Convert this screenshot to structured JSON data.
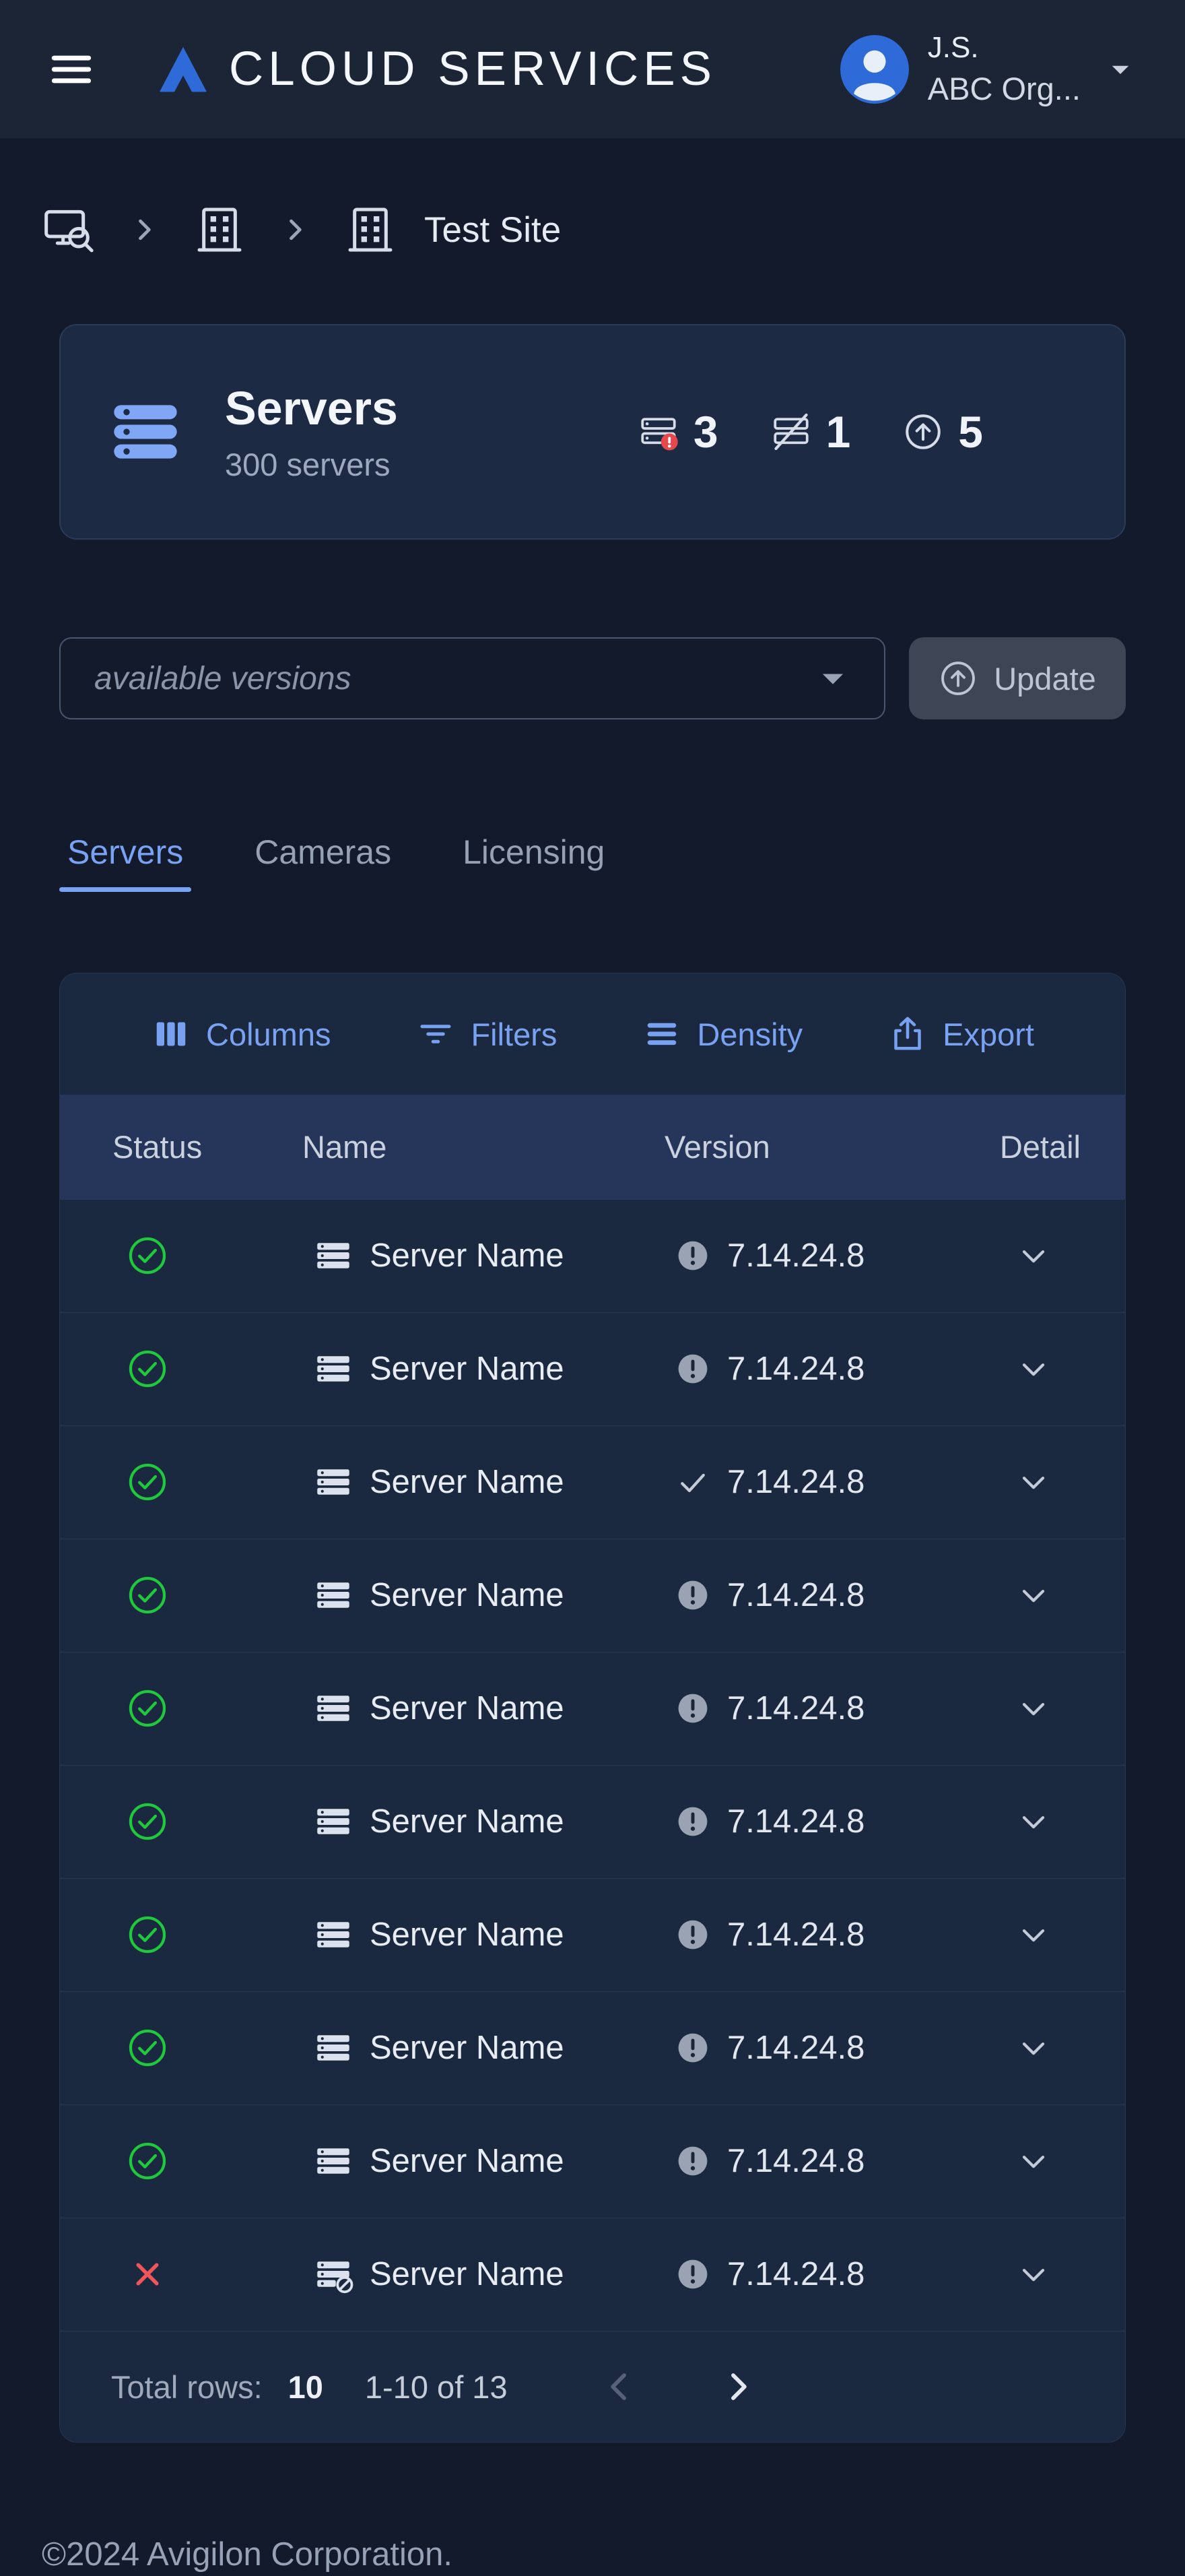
{
  "colors": {
    "accent_blue": "#79A1F2",
    "logo_blue": "#2E6BD9",
    "status_green": "#1FC93C",
    "status_red": "#F2545B"
  },
  "header": {
    "brand": "CLOUD SERVICES",
    "user_initials": "J.S.",
    "user_org": "ABC Org..."
  },
  "breadcrumb": {
    "site_label": "Test Site"
  },
  "summary": {
    "title": "Servers",
    "subtitle": "300 servers",
    "stats": [
      {
        "icon": "server-error-icon",
        "value": "3"
      },
      {
        "icon": "server-disconnected-icon",
        "value": "1"
      },
      {
        "icon": "update-available-icon",
        "value": "5"
      }
    ]
  },
  "update_bar": {
    "version_placeholder": "available versions",
    "update_label": "Update"
  },
  "tabs": [
    {
      "label": "Servers",
      "active": true
    },
    {
      "label": "Cameras",
      "active": false
    },
    {
      "label": "Licensing",
      "active": false
    }
  ],
  "table": {
    "toolbar": [
      {
        "label": "Columns",
        "icon": "columns-icon"
      },
      {
        "label": "Filters",
        "icon": "filters-icon"
      },
      {
        "label": "Density",
        "icon": "density-icon"
      },
      {
        "label": "Export",
        "icon": "export-icon"
      }
    ],
    "columns": [
      "Status",
      "Name",
      "Version",
      "Detail"
    ],
    "rows": [
      {
        "status": "ok",
        "disconnected": false,
        "name": "Server Name",
        "version": "7.14.24.8",
        "version_state": "warning"
      },
      {
        "status": "ok",
        "disconnected": false,
        "name": "Server Name",
        "version": "7.14.24.8",
        "version_state": "warning"
      },
      {
        "status": "ok",
        "disconnected": false,
        "name": "Server Name",
        "version": "7.14.24.8",
        "version_state": "ok"
      },
      {
        "status": "ok",
        "disconnected": false,
        "name": "Server Name",
        "version": "7.14.24.8",
        "version_state": "warning"
      },
      {
        "status": "ok",
        "disconnected": false,
        "name": "Server Name",
        "version": "7.14.24.8",
        "version_state": "warning"
      },
      {
        "status": "ok",
        "disconnected": false,
        "name": "Server Name",
        "version": "7.14.24.8",
        "version_state": "warning"
      },
      {
        "status": "ok",
        "disconnected": false,
        "name": "Server Name",
        "version": "7.14.24.8",
        "version_state": "warning"
      },
      {
        "status": "ok",
        "disconnected": false,
        "name": "Server Name",
        "version": "7.14.24.8",
        "version_state": "warning"
      },
      {
        "status": "ok",
        "disconnected": false,
        "name": "Server Name",
        "version": "7.14.24.8",
        "version_state": "warning"
      },
      {
        "status": "error",
        "disconnected": true,
        "name": "Server Name",
        "version": "7.14.24.8",
        "version_state": "warning"
      }
    ],
    "footer": {
      "total_rows_label": "Total rows:",
      "total_rows_value": "10",
      "range_label": "1-10 of 13"
    }
  },
  "page_footer": {
    "copyright": "©2024 Avigilon Corporation."
  }
}
